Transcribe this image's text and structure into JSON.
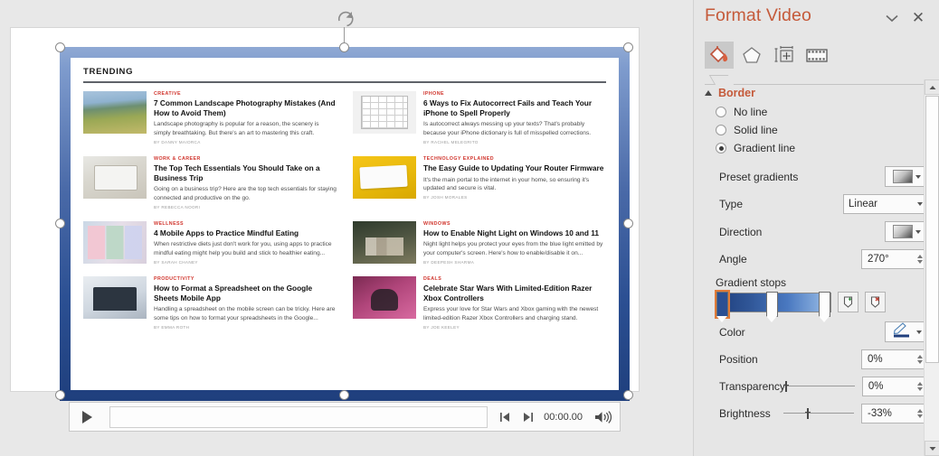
{
  "slide": {
    "rotate_handle": "rotation-handle"
  },
  "video_page": {
    "section_label": "TRENDING",
    "articles": [
      {
        "kicker": "CREATIVE",
        "headline": "7 Common Landscape Photography Mistakes (And How to Avoid Them)",
        "dek": "Landscape photography is popular for a reason, the scenery is simply breathtaking. But there's an art to mastering this craft.",
        "byline": "BY DANNY MAIORCA"
      },
      {
        "kicker": "IPHONE",
        "headline": "6 Ways to Fix Autocorrect Fails and Teach Your iPhone to Spell Properly",
        "dek": "Is autocorrect always messing up your texts? That's probably because your iPhone dictionary is full of misspelled corrections.",
        "byline": "BY RACHEL MELEGRITO"
      },
      {
        "kicker": "WORK & CAREER",
        "headline": "The Top Tech Essentials You Should Take on a Business Trip",
        "dek": "Going on a business trip? Here are the top tech essentials for staying connected and productive on the go.",
        "byline": "BY REBECCA NOORI"
      },
      {
        "kicker": "TECHNOLOGY EXPLAINED",
        "headline": "The Easy Guide to Updating Your Router Firmware",
        "dek": "It's the main portal to the internet in your home, so ensuring it's updated and secure is vital.",
        "byline": "BY JOSH MORALES"
      },
      {
        "kicker": "WELLNESS",
        "headline": "4 Mobile Apps to Practice Mindful Eating",
        "dek": "When restrictive diets just don't work for you, using apps to practice mindful eating might help you build and stick to healthier eating...",
        "byline": "BY SARAH CHANEY"
      },
      {
        "kicker": "WINDOWS",
        "headline": "How to Enable Night Light on Windows 10 and 11",
        "dek": "Night light helps you protect your eyes from the blue light emitted by your computer's screen. Here's how to enable/disable it on...",
        "byline": "BY DEEPESH SHARMA"
      },
      {
        "kicker": "PRODUCTIVITY",
        "headline": "How to Format a Spreadsheet on the Google Sheets Mobile App",
        "dek": "Handling a spreadsheet on the mobile screen can be tricky. Here are some tips on how to format your spreadsheets in the Google...",
        "byline": "BY EMMA ROTH"
      },
      {
        "kicker": "DEALS",
        "headline": "Celebrate Star Wars With Limited-Edition Razer Xbox Controllers",
        "dek": "Express your love for Star Wars and Xbox gaming with the newest limited-edition Razer Xbox Controllers and charging stand.",
        "byline": "BY JOE KEELEY"
      }
    ]
  },
  "player": {
    "play_label": "play-icon",
    "prev_frame_label": "previous-frame-icon",
    "next_frame_label": "next-frame-icon",
    "time": "00:00.00",
    "volume_label": "volume-icon"
  },
  "panel": {
    "title": "Format Video",
    "close_label": "✕",
    "tabs": [
      {
        "name": "fill-and-line",
        "label": "Fill & Line",
        "active": true
      },
      {
        "name": "effects",
        "label": "Effects",
        "active": false
      },
      {
        "name": "size-and-properties",
        "label": "Size & Properties",
        "active": false
      },
      {
        "name": "video",
        "label": "Video",
        "active": false
      }
    ],
    "section": {
      "title": "Border",
      "expanded": true
    },
    "line_options": [
      {
        "label": "No line",
        "accesskey": "N",
        "checked": false
      },
      {
        "label": "Solid line",
        "accesskey": "S",
        "checked": false
      },
      {
        "label": "Gradient line",
        "accesskey": "G",
        "checked": true
      }
    ],
    "fields": {
      "preset_gradients_label": "Preset gradients",
      "type_label": "Type",
      "type_value": "Linear",
      "direction_label": "Direction",
      "angle_label": "Angle",
      "angle_value": "270°",
      "gradient_stops_label": "Gradient stops",
      "color_label": "Color",
      "position_label": "Position",
      "position_value": "0%",
      "transparency_label": "Transparency",
      "transparency_value": "0%",
      "brightness_label": "Brightness",
      "brightness_value": "-33%"
    },
    "gradient_stop_tools": {
      "add_label": "add-gradient-stop-icon",
      "remove_label": "remove-gradient-stop-icon"
    },
    "colors": {
      "accent": "#c55a3a",
      "gradient_start": "#1f3f7d",
      "gradient_mid": "#4978c0",
      "gradient_end": "#9dc0e8",
      "selection_outline": "#e07b39"
    }
  }
}
